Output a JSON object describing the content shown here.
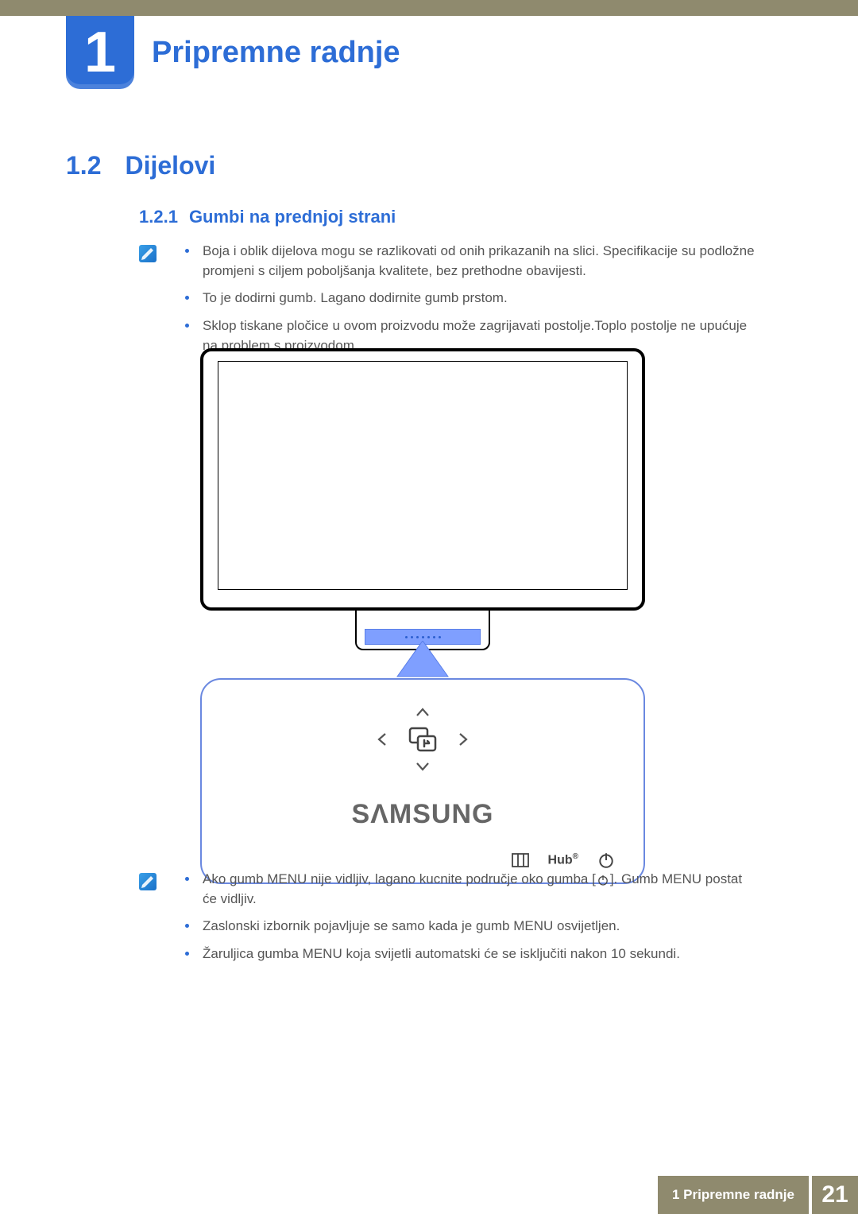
{
  "chapter": {
    "number": "1",
    "title": "Pripremne radnje"
  },
  "section": {
    "number": "1.2",
    "title": "Dijelovi"
  },
  "subsection": {
    "number": "1.2.1",
    "title": "Gumbi na prednjoj strani"
  },
  "notes_top": [
    "Boja i oblik dijelova mogu se razlikovati od onih prikazanih na slici. Specifikacije su podložne promjeni s ciljem poboljšanja kvalitete, bez prethodne obavijesti.",
    "To je dodirni gumb. Lagano dodirnite gumb prstom.",
    "Sklop tiskane pločice u ovom proizvodu može zagrijavati postolje.Toplo postolje ne upućuje na problem s proizvodom."
  ],
  "figure": {
    "brand": "SΛMSUNG",
    "hub_label": "Hub"
  },
  "notes_bottom": {
    "item1_pre": "Ako gumb MENU nije vidljiv, lagano kucnite područje oko gumba [",
    "item1_post": "]. Gumb MENU postat će vidljiv.",
    "item2": "Zaslonski izbornik pojavljuje se samo kada je gumb MENU osvijetljen.",
    "item3": "Žaruljica gumba MENU koja svijetli automatski će se isključiti nakon 10 sekundi."
  },
  "footer": {
    "text": "1 Pripremne radnje",
    "page": "21"
  }
}
